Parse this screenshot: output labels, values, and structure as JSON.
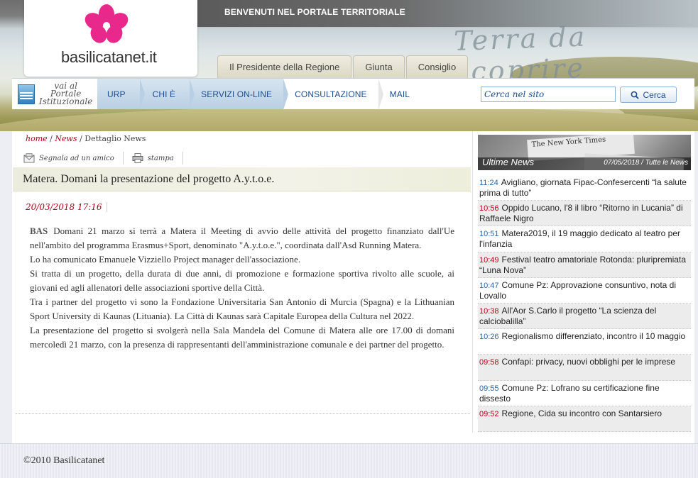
{
  "header": {
    "welcome": "BENVENUTI NEL PORTALE TERRITORIALE",
    "motto": "Terra da scoprire",
    "logo_text": "basilicatanet.it",
    "tabs": [
      {
        "label": "Il Presidente della Regione"
      },
      {
        "label": "Giunta"
      },
      {
        "label": "Consiglio"
      }
    ]
  },
  "nav": {
    "portal_line1": "vai al",
    "portal_line2": "Portale",
    "portal_line3": "Istituzionale",
    "items": [
      {
        "label": "URP"
      },
      {
        "label": "CHI È"
      },
      {
        "label": "SERVIZI ON-LINE"
      },
      {
        "label": "CONSULTAZIONE"
      },
      {
        "label": "MAIL"
      }
    ]
  },
  "search": {
    "placeholder": "Cerca nel sito",
    "button_label": "Cerca"
  },
  "breadcrumb": {
    "home": "home",
    "news": "News",
    "current": "Dettaglio News",
    "sep": "/"
  },
  "tools": {
    "signal": "Segnala ad un amico",
    "print": "stampa"
  },
  "article": {
    "title": "Matera. Domani la presentazione del progetto A.y.t.o.e.",
    "date": "20/03/2018 17:16",
    "source": "BAS",
    "paragraphs": [
      "Domani 21 marzo si terrà a Matera il Meeting di avvio delle attività del progetto finanziato dall'Ue nell'ambito del programma Erasmus+Sport, denominato \"A.y.t.o.e.\", coordinata dall'Asd Running Matera.",
      "Lo ha comunicato Emanuele Vizziello Project manager dell'associazione.",
      "Si tratta  di un progetto, della durata di due anni, di promozione e formazione sportiva rivolto alle scuole, ai giovani ed agli allenatori delle associazioni sportive della Città.",
      "Tra i partner del progetto vi sono la Fondazione Universitaria San Antonio di Murcia (Spagna) e la Lithuanian Sport University di Kaunas (Lituania).  La Città di Kaunas sarà Capitale Europea della Cultura nel 2022.",
      "La presentazione del progetto si svolgerà nella Sala Mandela del Comune di Matera alle ore 17.00 di domani mercoledì 21 marzo, con la presenza di rappresentanti dell'amministrazione comunale e dei partner del progetto."
    ]
  },
  "sidebar": {
    "title": "Ultime News",
    "meta": "07/05/2018 / Tutte le News",
    "paper_text": "The New York Times",
    "news": [
      {
        "time": "11:24",
        "color": "blue",
        "text": "Avigliano, giornata Fipac-Confesercenti “la salute prima di tutto”"
      },
      {
        "time": "10:56",
        "color": "red",
        "text": "Oppido Lucano, l'8 il libro “Ritorno in Lucania” di Raffaele Nigro"
      },
      {
        "time": "10:51",
        "color": "blue",
        "text": "Matera2019, il 19 maggio dedicato al teatro per l'infanzia"
      },
      {
        "time": "10:49",
        "color": "red",
        "text": "Festival teatro amatoriale Rotonda: pluripremiata “Luna Nova”"
      },
      {
        "time": "10:47",
        "color": "blue",
        "text": "Comune Pz: Approvazione consuntivo, nota di Lovallo"
      },
      {
        "time": "10:38",
        "color": "red",
        "text": "All'Aor S.Carlo il progetto “La scienza del calciobalilla”"
      },
      {
        "time": "10:26",
        "color": "blue",
        "text": "Regionalismo differenziato, incontro il 10 maggio"
      },
      {
        "time": "09:58",
        "color": "red",
        "text": "Confapi: privacy, nuovi obblighi per le imprese"
      },
      {
        "time": "09:55",
        "color": "blue",
        "text": "Comune Pz: Lofrano su certificazione fine dissesto"
      },
      {
        "time": "09:52",
        "color": "red",
        "text": "Regione, Cida su incontro con Santarsiero"
      }
    ]
  },
  "footer": {
    "copyright": "©2010 Basilicatanet"
  },
  "colors": {
    "accent_red": "#b3001b",
    "link_blue": "#1f4d8a",
    "time_blue": "#2a66a8",
    "logo_pink": "#e8288a"
  },
  "icons": [
    "portal-emblem-icon",
    "search-icon",
    "mail-icon",
    "print-icon",
    "flower-logo-icon"
  ]
}
